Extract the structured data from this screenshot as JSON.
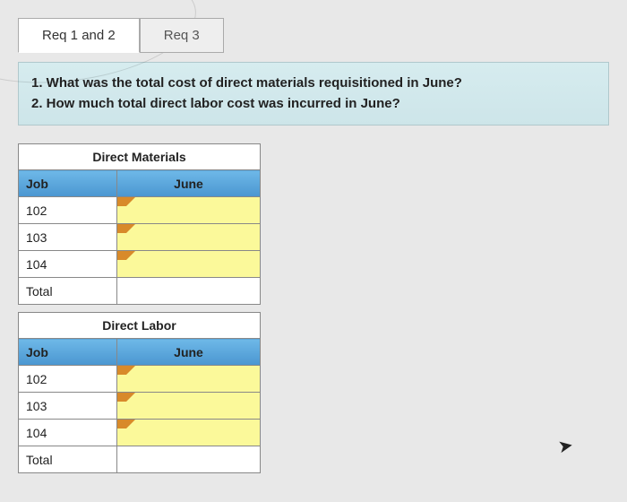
{
  "tabs": {
    "tab1": "Req 1 and 2",
    "tab2": "Req 3"
  },
  "questions": {
    "q1": "1. What was the total cost of direct materials requisitioned in June?",
    "q2": "2. How much total direct labor cost was incurred in June?"
  },
  "table1": {
    "title": "Direct Materials",
    "col1": "Job",
    "col2": "June",
    "rows": {
      "r1": "102",
      "r2": "103",
      "r3": "104",
      "r4": "Total"
    }
  },
  "table2": {
    "title": "Direct Labor",
    "col1": "Job",
    "col2": "June",
    "rows": {
      "r1": "102",
      "r2": "103",
      "r3": "104",
      "r4": "Total"
    }
  },
  "chart_data": [
    {
      "type": "table",
      "title": "Direct Materials",
      "columns": [
        "Job",
        "June"
      ],
      "rows": [
        {
          "Job": "102",
          "June": null
        },
        {
          "Job": "103",
          "June": null
        },
        {
          "Job": "104",
          "June": null
        },
        {
          "Job": "Total",
          "June": null
        }
      ]
    },
    {
      "type": "table",
      "title": "Direct Labor",
      "columns": [
        "Job",
        "June"
      ],
      "rows": [
        {
          "Job": "102",
          "June": null
        },
        {
          "Job": "103",
          "June": null
        },
        {
          "Job": "104",
          "June": null
        },
        {
          "Job": "Total",
          "June": null
        }
      ]
    }
  ]
}
